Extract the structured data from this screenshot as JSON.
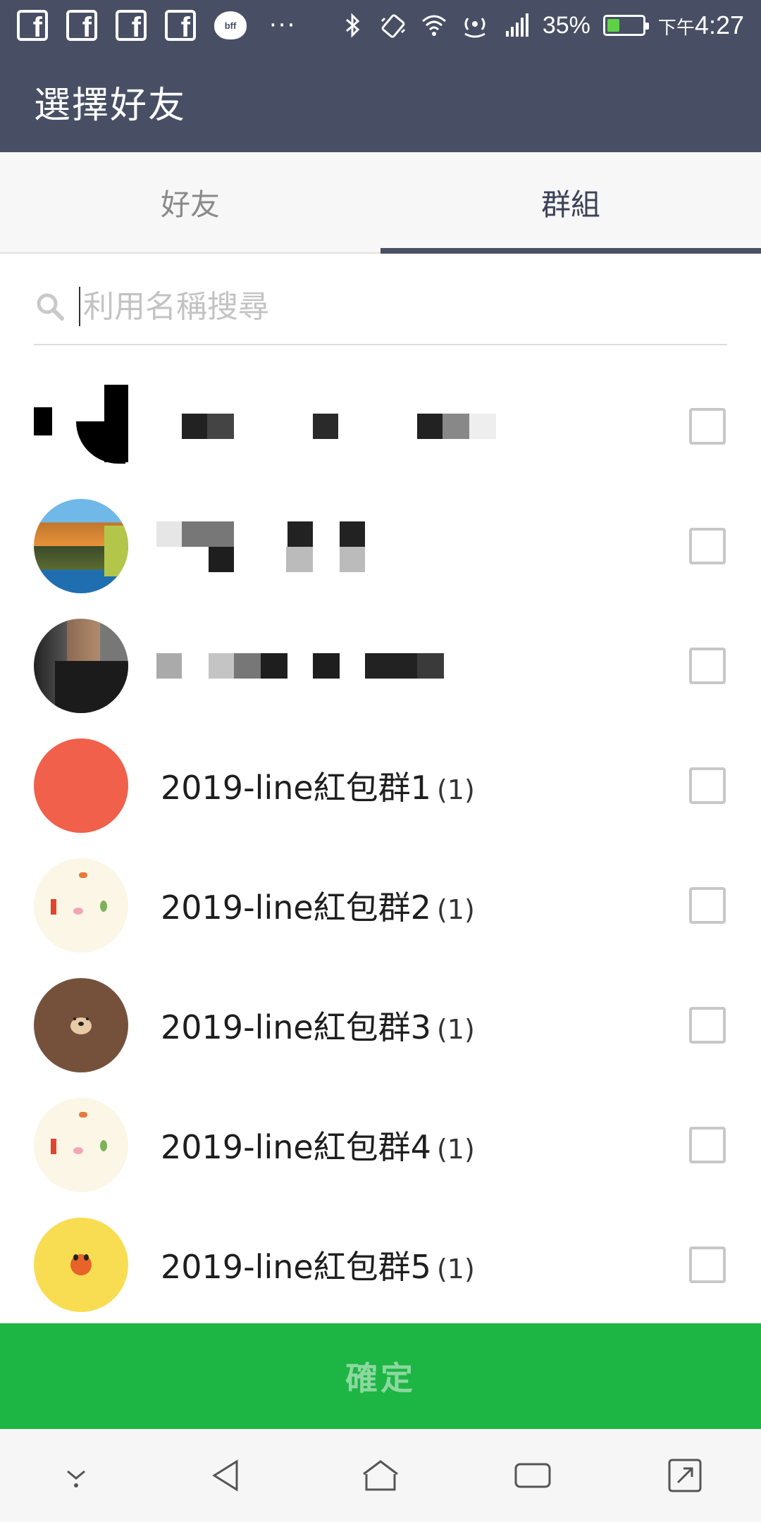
{
  "status_bar": {
    "bff_label": "bff",
    "more": "···",
    "battery_percent": "35%",
    "battery_level": 0.35,
    "time_ampm": "下午",
    "time": "4:27",
    "icons": [
      "facebook-icon",
      "facebook-icon",
      "facebook-icon",
      "facebook-icon",
      "bff-icon",
      "bluetooth-icon",
      "vibrate-icon",
      "wifi-icon",
      "hotspot-icon",
      "signal-icon",
      "battery-icon"
    ]
  },
  "header": {
    "title": "選擇好友"
  },
  "tabs": [
    {
      "label": "好友",
      "active": false
    },
    {
      "label": "群組",
      "active": true
    }
  ],
  "search": {
    "placeholder": "利用名稱搜尋",
    "value": ""
  },
  "list": {
    "items": [
      {
        "name": "2019-line紅包群1",
        "count": "(1)",
        "avatar_color": "#f0604a"
      },
      {
        "name": "2019-line紅包群2",
        "count": "(1)",
        "avatar_color": "#fbf6e6"
      },
      {
        "name": "2019-line紅包群3",
        "count": "(1)",
        "avatar_color": "#75513b"
      },
      {
        "name": "2019-line紅包群4",
        "count": "(1)",
        "avatar_color": "#fbf6e6"
      },
      {
        "name": "2019-line紅包群5",
        "count": "(1)",
        "avatar_color": "#f8dd52"
      }
    ]
  },
  "confirm": {
    "label": "確定"
  },
  "colors": {
    "header_bg": "#484f64",
    "confirm_bg": "#1db544",
    "tab_indicator": "#4a5063"
  },
  "nav_bar": {
    "icons": [
      "hide-keyboard-icon",
      "back-icon",
      "home-icon",
      "recents-icon",
      "screenshot-icon"
    ]
  }
}
